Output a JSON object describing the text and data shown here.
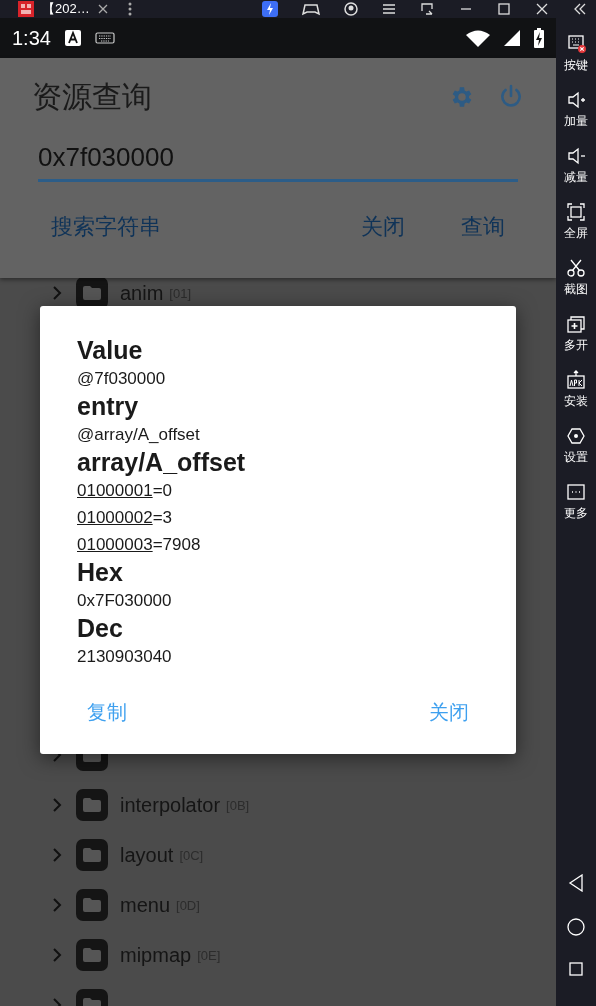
{
  "emulator_bar": {
    "tab_title": "【202…"
  },
  "status_bar": {
    "time": "1:34"
  },
  "app": {
    "title": "资源查询",
    "query": "0x7f030000",
    "actions": [
      "搜索字符串",
      "关闭",
      "查询"
    ]
  },
  "tree": {
    "top_rows": [
      {
        "kind": "folder",
        "name": "anim",
        "id": "[01]"
      }
    ],
    "bottom_rows": [
      {
        "kind": "cut"
      },
      {
        "kind": "folder",
        "name": "interpolator",
        "id": "[0B]"
      },
      {
        "kind": "folder",
        "name": "layout",
        "id": "[0C]"
      },
      {
        "kind": "folder",
        "name": "menu",
        "id": "[0D]"
      },
      {
        "kind": "folder",
        "name": "mipmap",
        "id": "[0E]"
      },
      {
        "kind": "cut"
      }
    ]
  },
  "dialog": {
    "lines": [
      {
        "kind": "heading",
        "text": "Value"
      },
      {
        "kind": "text",
        "text": "@7f030000"
      },
      {
        "kind": "heading",
        "text": "entry"
      },
      {
        "kind": "text",
        "text": "@array/A_offset"
      },
      {
        "kind": "heading",
        "text": "array/A_offset"
      },
      {
        "kind": "pair",
        "key": "01000001",
        "value": "=0"
      },
      {
        "kind": "pair",
        "key": "01000002",
        "value": "=3"
      },
      {
        "kind": "pair",
        "key": "01000003",
        "value": "=7908"
      },
      {
        "kind": "heading",
        "text": "Hex"
      },
      {
        "kind": "text",
        "text": "0x7F030000"
      },
      {
        "kind": "heading",
        "text": "Dec"
      },
      {
        "kind": "text",
        "text": "2130903040"
      }
    ],
    "buttons": [
      "复制",
      "关闭"
    ]
  },
  "sidebar": {
    "items": [
      "按键",
      "加量",
      "减量",
      "全屏",
      "截图",
      "多开",
      "安装",
      "设置",
      "更多"
    ]
  }
}
